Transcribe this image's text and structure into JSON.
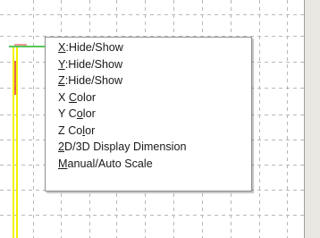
{
  "context_menu": {
    "items": [
      {
        "id": "x-hide-show",
        "label": "X:Hide/Show",
        "mnemonic_index": 0
      },
      {
        "id": "y-hide-show",
        "label": "Y:Hide/Show",
        "mnemonic_index": 0
      },
      {
        "id": "z-hide-show",
        "label": "Z:Hide/Show",
        "mnemonic_index": 0
      },
      {
        "id": "x-color",
        "label": "X Color",
        "mnemonic_index": 2
      },
      {
        "id": "y-color",
        "label": "Y Color",
        "mnemonic_index": 3
      },
      {
        "id": "z-color",
        "label": "Z Color",
        "mnemonic_index": 4
      },
      {
        "id": "display-dimension",
        "label": "2D/3D Display Dimension",
        "mnemonic_index": 0
      },
      {
        "id": "manual-auto-scale",
        "label": "Manual/Auto Scale",
        "mnemonic_index": 0
      }
    ]
  },
  "colors": {
    "grid_line": "#b8b8b8",
    "trace_yellow": "#f2f200",
    "trace_green": "#58c858",
    "trace_red": "#e03030",
    "menu_text": "#1a1a1a",
    "menu_border": "#8f8f8f",
    "background": "#ffffff",
    "right_strip": "#e9e7e1"
  }
}
